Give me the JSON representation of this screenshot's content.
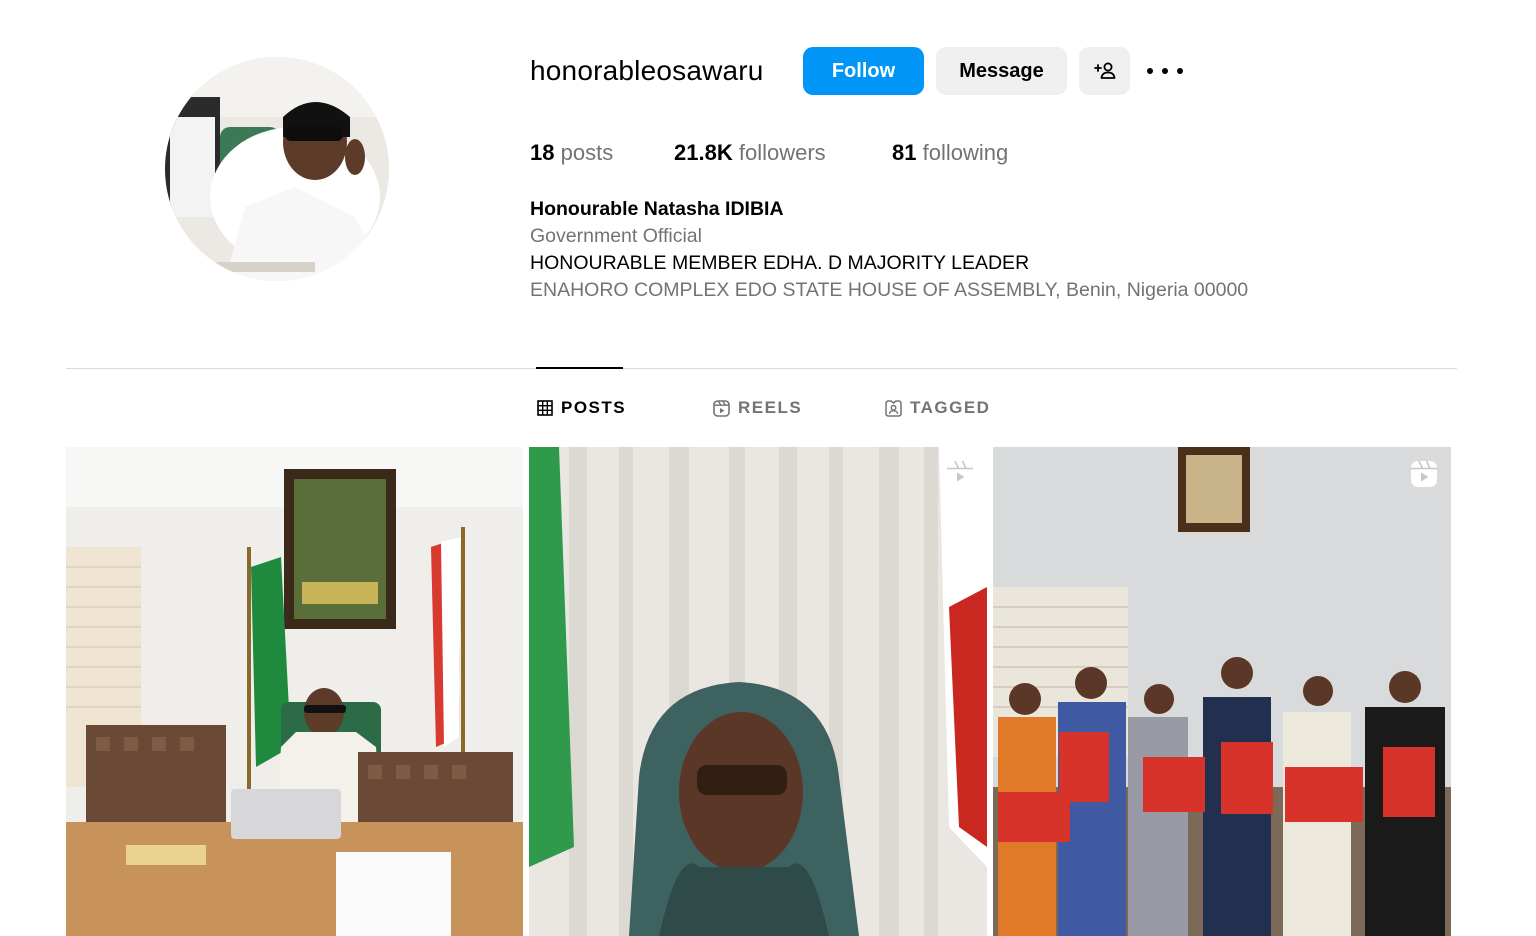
{
  "profile": {
    "username": "honorableosawaru",
    "follow_label": "Follow",
    "message_label": "Message",
    "adduser_icon": "add-user-icon",
    "more_icon": "more-options-icon"
  },
  "stats": {
    "posts_count": "18",
    "posts_label": "posts",
    "followers_count": "21.8K",
    "followers_label": "followers",
    "following_count": "81",
    "following_label": "following"
  },
  "bio": {
    "full_name": "Honourable Natasha IDIBIA",
    "category": "Government Official",
    "line1": "HONOURABLE MEMBER EDHA. D MAJORITY LEADER",
    "address": "ENAHORO COMPLEX EDO STATE HOUSE OF ASSEMBLY, Benin, Nigeria 00000"
  },
  "tabs": [
    {
      "label": "POSTS",
      "icon": "grid-icon",
      "active": true
    },
    {
      "label": "REELS",
      "icon": "reels-icon",
      "active": false
    },
    {
      "label": "TAGGED",
      "icon": "tagged-icon",
      "active": false
    }
  ],
  "posts": [
    {
      "type": "photo"
    },
    {
      "type": "reel",
      "icon": "reel-icon"
    },
    {
      "type": "reel",
      "icon": "reel-icon"
    }
  ],
  "colors": {
    "accent": "#0095f6",
    "secondary_button": "#efefef",
    "muted_text": "#737373",
    "divider": "#dbdbdb"
  }
}
